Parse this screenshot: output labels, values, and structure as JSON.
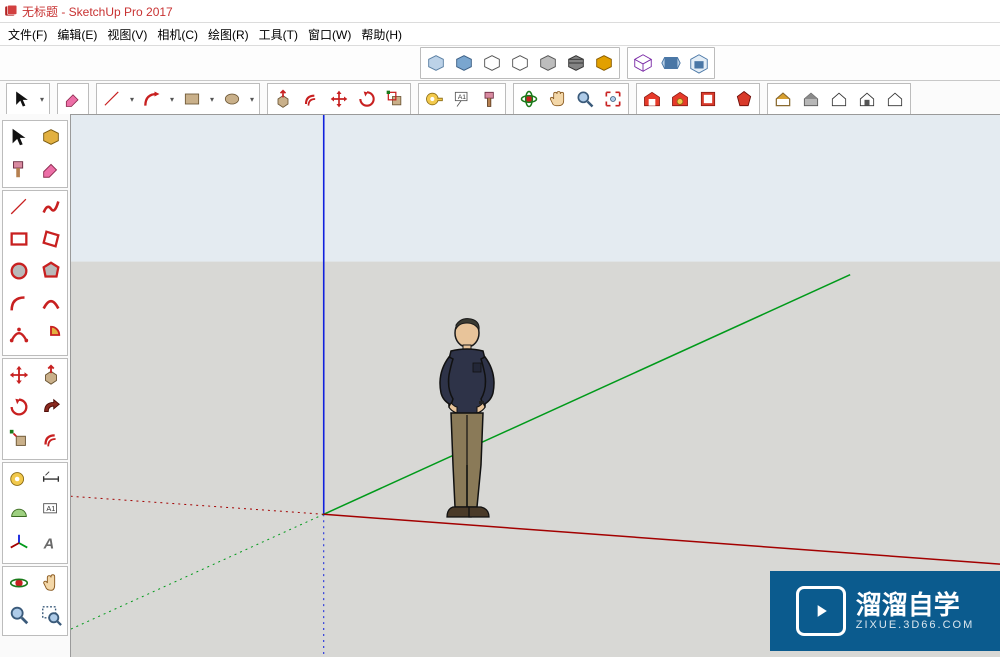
{
  "titlebar": {
    "app_name": "无标题 - SketchUp Pro 2017"
  },
  "menu": {
    "file": "文件(F)",
    "edit": "编辑(E)",
    "view": "视图(V)",
    "camera": "相机(C)",
    "draw": "绘图(R)",
    "tools": "工具(T)",
    "window": "窗口(W)",
    "help": "帮助(H)"
  },
  "icons": {
    "select": "select",
    "eraser": "eraser",
    "pencil": "line",
    "arc": "arc",
    "rect": "rectangle",
    "circle": "circle",
    "pushpull": "push-pull",
    "offset": "offset",
    "move": "move",
    "rotate": "rotate",
    "scale": "scale",
    "tape": "tape",
    "text": "text",
    "paint": "paint",
    "orbit": "orbit",
    "pan": "pan",
    "zoom": "zoom",
    "zoom_ext": "zoom-extents",
    "warehouse": "warehouse"
  },
  "watermark": {
    "big": "溜溜自学",
    "small": "ZIXUE.3D66.COM"
  },
  "colors": {
    "axis_x": "#a30000",
    "axis_y": "#009a1a",
    "axis_z": "#1020dd",
    "axis_neg": "#8a8a8a"
  }
}
